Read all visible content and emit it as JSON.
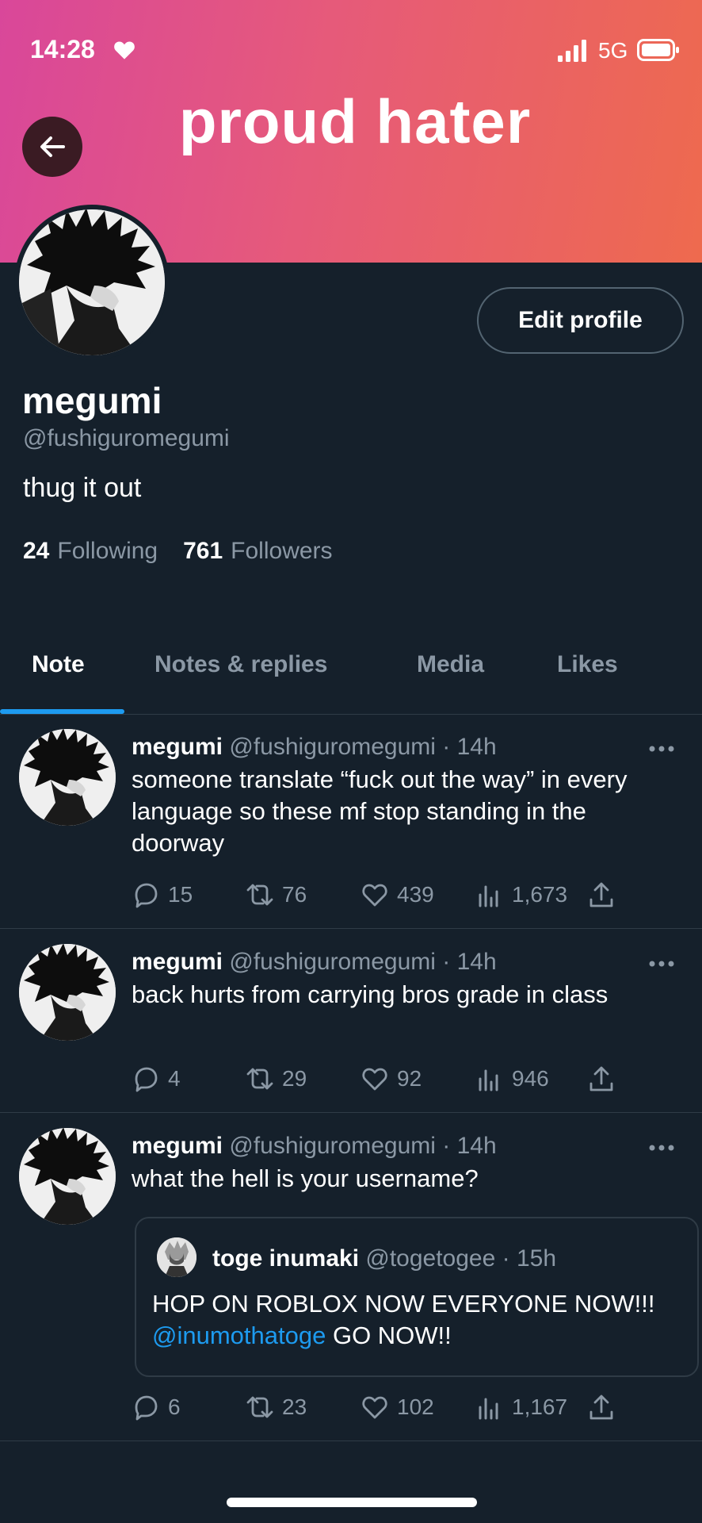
{
  "status_bar": {
    "time": "14:28",
    "network": "5G"
  },
  "banner": {
    "text": "proud hater"
  },
  "profile": {
    "display_name": "megumi",
    "handle": "@fushiguromegumi",
    "bio": "thug it out",
    "following_count": "24",
    "following_label": "Following",
    "followers_count": "761",
    "followers_label": "Followers",
    "edit_label": "Edit profile"
  },
  "tabs": [
    {
      "label": "Note",
      "active": true
    },
    {
      "label": "Notes & replies",
      "active": false
    },
    {
      "label": "Media",
      "active": false
    },
    {
      "label": "Likes",
      "active": false
    }
  ],
  "notes": [
    {
      "name": "megumi",
      "meta": "@fushiguromegumi · 14h",
      "text": "someone translate “fuck out the way” in every language so these mf stop standing in the doorway",
      "replies": "15",
      "renotes": "76",
      "likes": "439",
      "views": "1,673"
    },
    {
      "name": "megumi",
      "meta": "@fushiguromegumi · 14h",
      "text": "back hurts from carrying bros grade in class",
      "replies": "4",
      "renotes": "29",
      "likes": "92",
      "views": "946"
    },
    {
      "name": "megumi",
      "meta": "@fushiguromegumi · 14h",
      "text": "what the hell is your username?",
      "replies": "6",
      "renotes": "23",
      "likes": "102",
      "views": "1,167",
      "quote": {
        "name": "toge inumaki",
        "meta": "@togetogee · 15h",
        "text_before": "HOP ON ROBLOX NOW EVERYONE NOW!!! ",
        "mention": "@inumothatoge",
        "text_after": " GO NOW!!"
      }
    }
  ],
  "colors": {
    "accent": "#1d9bf0",
    "background": "#15202b",
    "muted": "#8b98a5"
  }
}
